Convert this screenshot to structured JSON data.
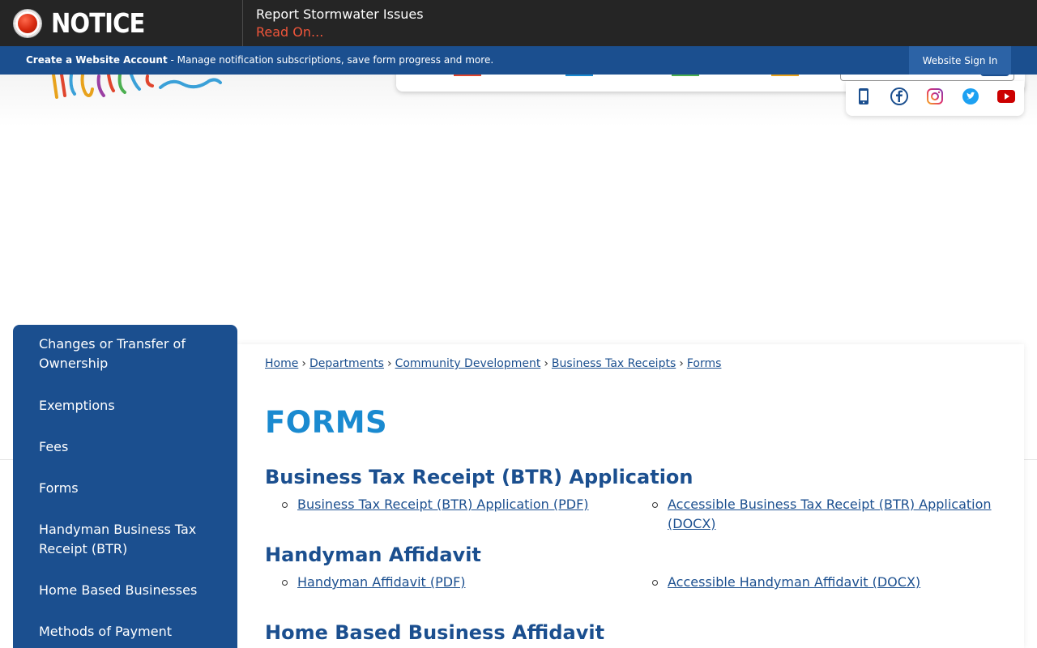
{
  "notice": {
    "title": "NOTICE",
    "headline": "Report Stormwater Issues",
    "link": "Read On..."
  },
  "account_bar": {
    "create_label": "Create a Website Account",
    "description": " - Manage notification subscriptions, save form progress and more.",
    "signin_label": "Website Sign In"
  },
  "social": [
    "mobile-icon",
    "facebook-icon",
    "instagram-icon",
    "twitter-icon",
    "youtube-icon"
  ],
  "colors": {
    "primary_blue": "#1b4f8f",
    "title_blue": "#1a8ad0",
    "notice_red": "#f0553a",
    "notice_bg": "#252525"
  },
  "sidebar": {
    "items": [
      {
        "label": "Changes or Transfer of Ownership"
      },
      {
        "label": "Exemptions"
      },
      {
        "label": "Fees"
      },
      {
        "label": "Forms"
      },
      {
        "label": "Handyman Business Tax Receipt (BTR)"
      },
      {
        "label": "Home Based Businesses"
      },
      {
        "label": "Methods of Payment"
      }
    ]
  },
  "breadcrumb": [
    "Home",
    "Departments",
    "Community Development",
    "Business Tax Receipts",
    "Forms"
  ],
  "page": {
    "title": "FORMS",
    "sections": [
      {
        "title": "Business Tax Receipt (BTR) Application",
        "links": [
          "Business Tax Receipt (BTR) Application (PDF)",
          "Accessible Business Tax Receipt (BTR) Application (DOCX)"
        ]
      },
      {
        "title": "Handyman Affidavit",
        "links": [
          "Handyman Affidavit (PDF)",
          "Accessible Handyman Affidavit (DOCX)"
        ]
      },
      {
        "title": "Home Based Business Affidavit",
        "links": []
      }
    ]
  }
}
